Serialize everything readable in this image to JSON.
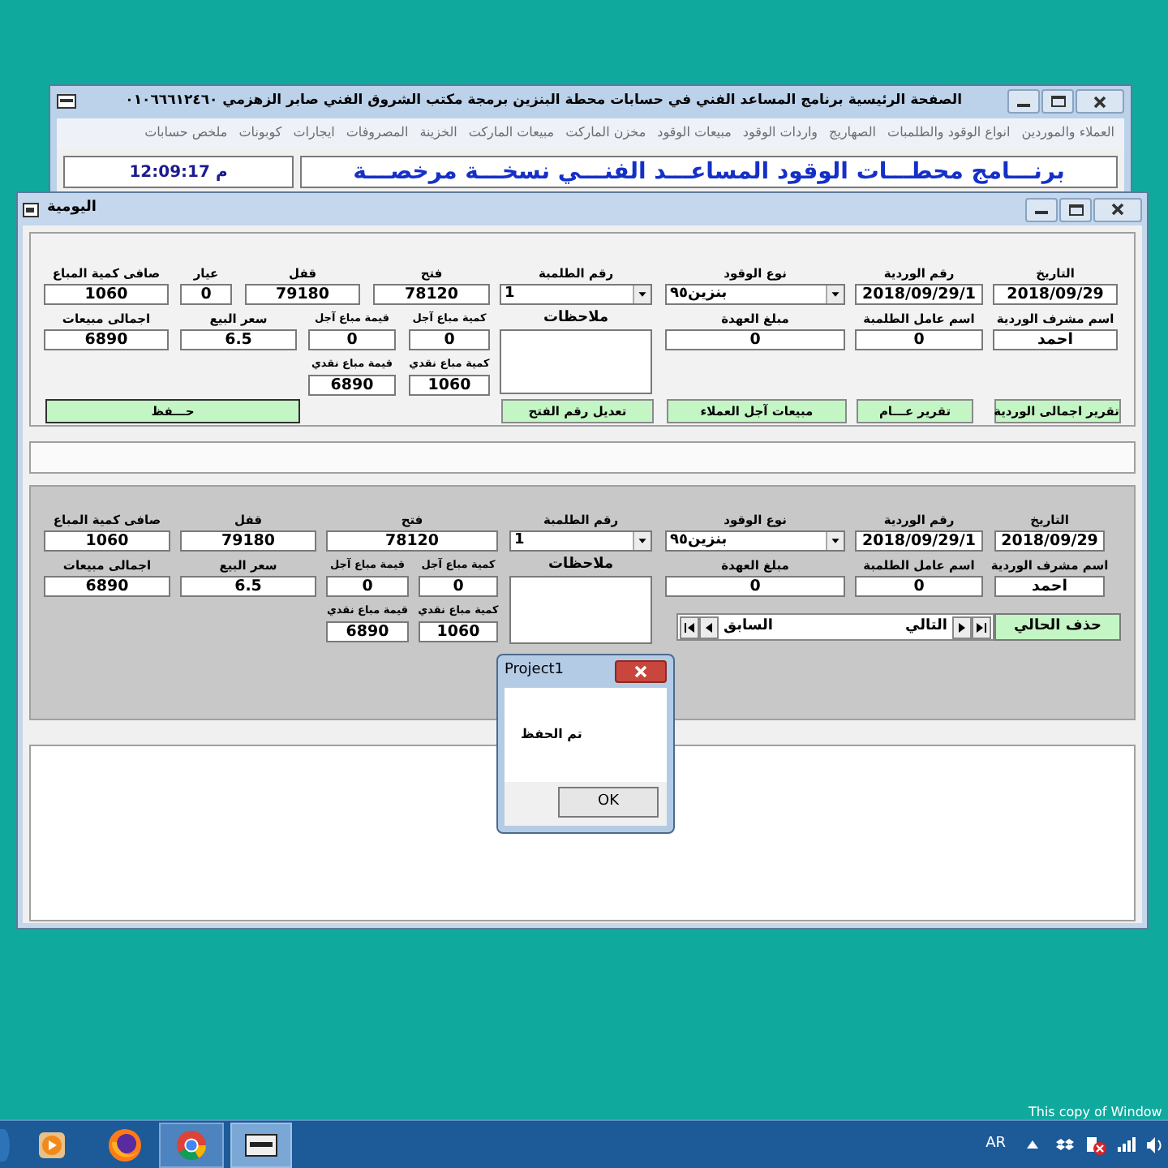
{
  "main_window": {
    "title": "الصفحة الرئيسية برنامج المساعد الفني في حسابات محطة البنزين  برمجة  مكتب الشروق الفني  صابر الزهزمي  ٠١٠٦٦٦١٢٤٦٠",
    "menu": [
      {
        "label": "العملاء والموردين"
      },
      {
        "label": "انواع الوقود والطلمبات"
      },
      {
        "label": "الصهاريج"
      },
      {
        "label": "واردات الوقود"
      },
      {
        "label": "مبيعات الوقود"
      },
      {
        "label": "مخزن الماركت"
      },
      {
        "label": "مبيعات الماركت"
      },
      {
        "label": "الخزينة"
      },
      {
        "label": "المصروفات"
      },
      {
        "label": "ايجارات"
      },
      {
        "label": "كوبونات"
      },
      {
        "label": "ملخص حسابات"
      }
    ],
    "clock": "12:09:17 م",
    "banner": "برنـــامج محطـــات الوقود المساعـــد الفنـــي نسخـــة مرخصـــة"
  },
  "daily_window": {
    "title": "اليومية",
    "panels": [
      {
        "top_fields": [
          {
            "label": "التاريخ",
            "value": "2018/09/29",
            "kind": "text"
          },
          {
            "label": "رقم الوردية",
            "value": "2018/09/29/1",
            "kind": "text"
          },
          {
            "label": "نوع الوقود",
            "value": "بنزين٩٥",
            "kind": "combo"
          },
          {
            "label": "رقم الطلمبة",
            "value": "1",
            "kind": "combo"
          },
          {
            "label": "فتح",
            "value": "78120",
            "kind": "text"
          },
          {
            "label": "قفل",
            "value": "79180",
            "kind": "text"
          },
          {
            "label": "عيار",
            "value": "0",
            "kind": "text"
          },
          {
            "label": "صافى كمية المباع",
            "value": "1060",
            "kind": "text"
          }
        ],
        "middle_fields": [
          {
            "label": "اسم مشرف الوردية",
            "value": "احمد"
          },
          {
            "label": "اسم عامل الطلمبة",
            "value": "0"
          },
          {
            "label": "مبلغ العهدة",
            "value": "0"
          }
        ],
        "notes_label": "ملاحظات",
        "sales_fields": [
          {
            "label": "كمية مباع آجل",
            "value": "0"
          },
          {
            "label": "قيمة مباع آجل",
            "value": "0"
          },
          {
            "label": "كمية مباع نقدي",
            "value": "1060"
          },
          {
            "label": "قيمة مباع نقدي",
            "value": "6890"
          }
        ],
        "side_fields": [
          {
            "label": "سعر البيع",
            "value": "6.5"
          },
          {
            "label": "اجمالى مبيعات",
            "value": "6890"
          }
        ],
        "buttons": [
          {
            "label": "تقرير اجمالى الوردية"
          },
          {
            "label": "تقرير عـــام"
          },
          {
            "label": "مبيعات آجل العملاء"
          },
          {
            "label": "تعديل رقم الفتح"
          },
          {
            "label": "حـــفظ"
          }
        ]
      },
      {
        "top_fields": [
          {
            "label": "التاريخ",
            "value": "2018/09/29",
            "kind": "text"
          },
          {
            "label": "رقم الوردية",
            "value": "2018/09/29/1",
            "kind": "text"
          },
          {
            "label": "نوع الوقود",
            "value": "بنزين٩٥",
            "kind": "combo"
          },
          {
            "label": "رقم الطلمبة",
            "value": "1",
            "kind": "combo"
          },
          {
            "label": "فتح",
            "value": "78120",
            "kind": "text"
          },
          {
            "label": "قفل",
            "value": "79180",
            "kind": "text"
          },
          {
            "label": "صافى كمية المباع",
            "value": "1060",
            "kind": "text"
          }
        ],
        "middle_fields": [
          {
            "label": "اسم مشرف الوردية",
            "value": "احمد"
          },
          {
            "label": "اسم عامل الطلمبة",
            "value": "0"
          },
          {
            "label": "مبلغ العهدة",
            "value": "0"
          }
        ],
        "notes_label": "ملاحظات",
        "sales_fields": [
          {
            "label": "كمية مباع آجل",
            "value": "0"
          },
          {
            "label": "قيمة مباع آجل",
            "value": "0"
          },
          {
            "label": "كمية مباع نقدي",
            "value": "1060"
          },
          {
            "label": "قيمة مباع نقدي",
            "value": "6890"
          }
        ],
        "side_fields": [
          {
            "label": "سعر البيع",
            "value": "6.5"
          },
          {
            "label": "اجمالى مبيعات",
            "value": "6890"
          }
        ],
        "delete_button": {
          "label": "حذف الحالي"
        },
        "navigator": {
          "previous": "السابق",
          "next": "التالي"
        }
      }
    ]
  },
  "dialog": {
    "title": "Project1",
    "message": "تم الحفظ",
    "button": "OK"
  },
  "desktop": {
    "activation_notice": "This copy of Window"
  },
  "taskbar": {
    "language": "AR"
  }
}
